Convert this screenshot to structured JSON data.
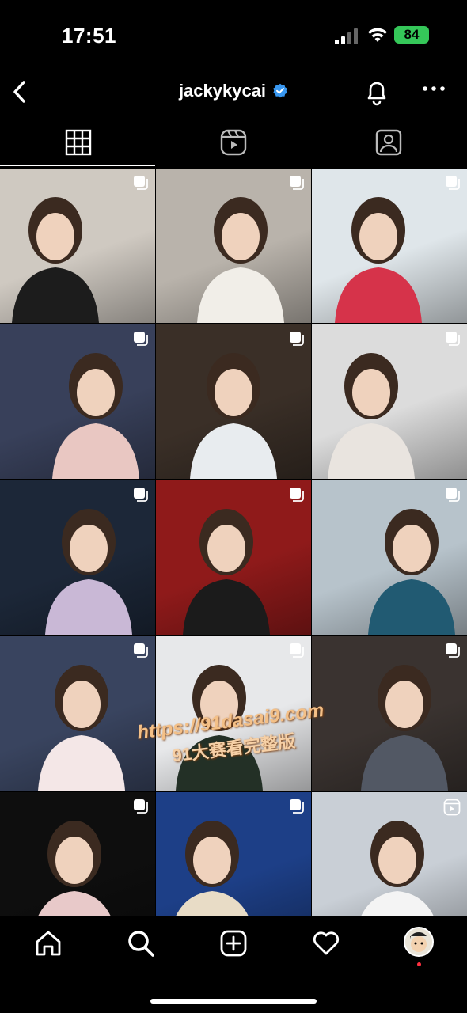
{
  "status_bar": {
    "time": "17:51",
    "battery": "84",
    "battery_color": "#35c759"
  },
  "header": {
    "username": "jackykycai",
    "verified": true,
    "verified_color": "#3897f0"
  },
  "tabs": [
    {
      "name": "posts",
      "icon": "grid-icon",
      "active": true
    },
    {
      "name": "reels",
      "icon": "reels-icon",
      "active": false
    },
    {
      "name": "tagged",
      "icon": "tagged-person-icon",
      "active": false
    }
  ],
  "posts": [
    {
      "type": "carousel",
      "bg": "#cfc9c1",
      "accent": "#1c1c1c"
    },
    {
      "type": "carousel",
      "bg": "#b9b3ab",
      "accent": "#f1eee8"
    },
    {
      "type": "carousel",
      "bg": "#dfe6ea",
      "accent": "#d6334a"
    },
    {
      "type": "carousel",
      "bg": "#38405a",
      "accent": "#e9c7c2"
    },
    {
      "type": "carousel",
      "bg": "#3a2f27",
      "accent": "#e8ecef"
    },
    {
      "type": "carousel",
      "bg": "#dcdcdc",
      "accent": "#e9e4df"
    },
    {
      "type": "carousel",
      "bg": "#1c2738",
      "accent": "#c9b8d6"
    },
    {
      "type": "carousel",
      "bg": "#8f1a1a",
      "accent": "#1b1b1b"
    },
    {
      "type": "carousel",
      "bg": "#b7c3cb",
      "accent": "#215a72"
    },
    {
      "type": "carousel",
      "bg": "#39445f",
      "accent": "#f4e7e7"
    },
    {
      "type": "carousel",
      "bg": "#e7e8ea",
      "accent": "#233026"
    },
    {
      "type": "carousel",
      "bg": "#3a3330",
      "accent": "#525864"
    },
    {
      "type": "carousel",
      "bg": "#0e0e0e",
      "accent": "#e8c9c9"
    },
    {
      "type": "carousel",
      "bg": "#1d3f87",
      "accent": "#e8dcc6"
    },
    {
      "type": "reel",
      "bg": "#c9cfd6",
      "accent": "#f4f4f4"
    }
  ],
  "watermark": {
    "line1": "https://91dasai9.com",
    "line2": "91大赛看完整版"
  },
  "bottom_nav": [
    {
      "name": "home",
      "icon": "home-icon"
    },
    {
      "name": "search",
      "icon": "search-icon"
    },
    {
      "name": "create",
      "icon": "add-post-icon"
    },
    {
      "name": "activity",
      "icon": "heart-icon"
    },
    {
      "name": "profile",
      "icon": "profile-avatar"
    }
  ]
}
